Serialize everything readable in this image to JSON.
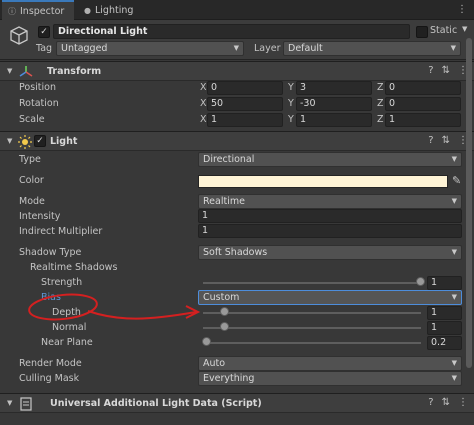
{
  "tabs": [
    {
      "label": "Inspector",
      "icon": "info-icon",
      "active": true
    },
    {
      "label": "Lighting",
      "icon": "bulb-icon",
      "active": false
    }
  ],
  "object": {
    "name": "Directional Light",
    "static_label": "Static",
    "tag_label": "Tag",
    "tag_value": "Untagged",
    "layer_label": "Layer",
    "layer_value": "Default"
  },
  "transform": {
    "title": "Transform",
    "position_label": "Position",
    "rotation_label": "Rotation",
    "scale_label": "Scale",
    "axes": [
      "X",
      "Y",
      "Z"
    ],
    "position": [
      "0",
      "3",
      "0"
    ],
    "rotation": [
      "50",
      "-30",
      "0"
    ],
    "scale": [
      "1",
      "1",
      "1"
    ]
  },
  "light": {
    "title": "Light",
    "type_label": "Type",
    "type_value": "Directional",
    "color_label": "Color",
    "color_value": "#FFF4D6",
    "mode_label": "Mode",
    "mode_value": "Realtime",
    "intensity_label": "Intensity",
    "intensity_value": "1",
    "indirect_label": "Indirect Multiplier",
    "indirect_value": "1",
    "shadow_type_label": "Shadow Type",
    "shadow_type_value": "Soft Shadows",
    "realtime_shadows_label": "Realtime Shadows",
    "strength_label": "Strength",
    "strength_value": "1",
    "bias_label": "Bias",
    "bias_value": "Custom",
    "depth_label": "Depth",
    "depth_value": "1",
    "normal_label": "Normal",
    "normal_value": "1",
    "near_plane_label": "Near Plane",
    "near_plane_value": "0.2",
    "render_mode_label": "Render Mode",
    "render_mode_value": "Auto",
    "culling_mask_label": "Culling Mask",
    "culling_mask_value": "Everything"
  },
  "additional": {
    "title": "Universal Additional Light Data (Script)"
  },
  "sliders": {
    "strength": 1.0,
    "depth": 0.1,
    "normal": 0.1,
    "near_plane": 0.02
  },
  "colors": {
    "accent": "#3A79BB",
    "annotation": "#D42020"
  }
}
